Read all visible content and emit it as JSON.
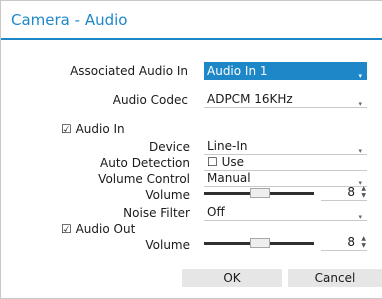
{
  "title": "Camera - Audio",
  "associated_audio_in": {
    "label": "Associated Audio In",
    "value": "Audio In 1"
  },
  "audio_codec": {
    "label": "Audio Codec",
    "value": "ADPCM 16KHz"
  },
  "audio_in": {
    "label": "Audio In",
    "checked": "☑",
    "device": {
      "label": "Device",
      "value": "Line-In"
    },
    "auto_detection": {
      "label": "Auto Detection",
      "option_label": "Use",
      "checked": "☐"
    },
    "volume_control": {
      "label": "Volume Control",
      "value": "Manual"
    },
    "volume": {
      "label": "Volume",
      "value": "8"
    },
    "noise_filter": {
      "label": "Noise Filter",
      "value": "Off"
    }
  },
  "audio_out": {
    "label": "Audio Out",
    "checked": "☑",
    "volume": {
      "label": "Volume",
      "value": "8"
    }
  },
  "buttons": {
    "ok": "OK",
    "cancel": "Cancel"
  },
  "icons": {
    "dropdown": "▾",
    "spin_up": "▲",
    "spin_down": "▼"
  }
}
